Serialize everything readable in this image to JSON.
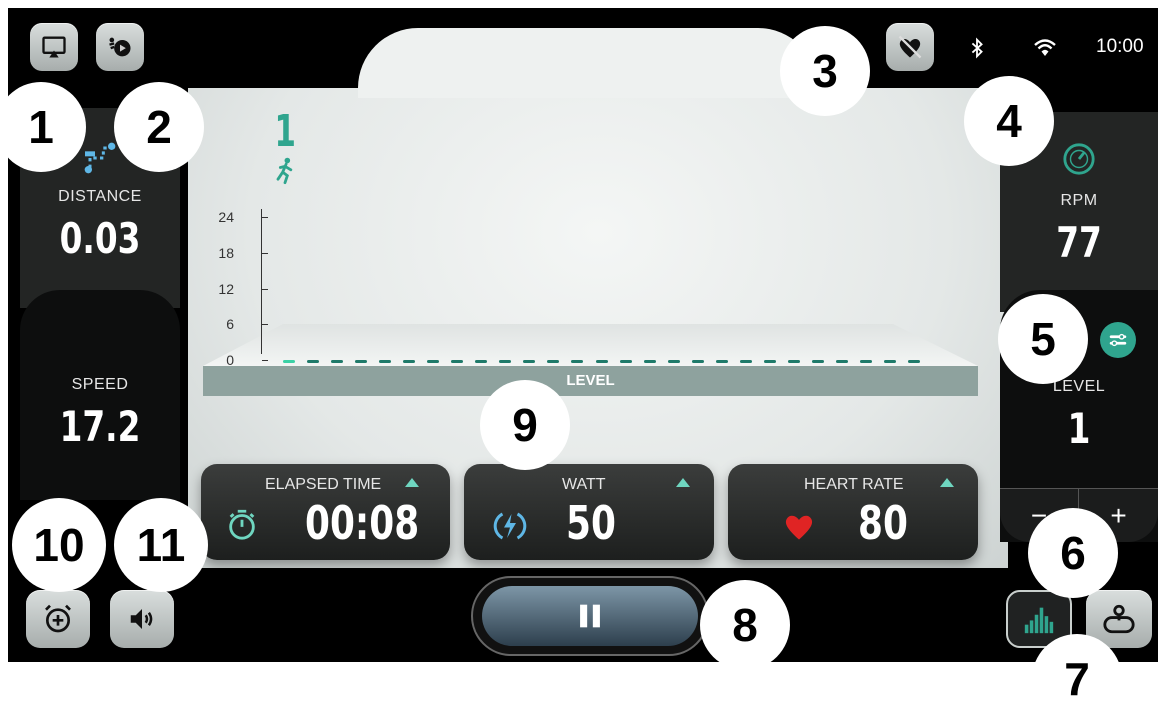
{
  "status_bar": {
    "time": "10:00"
  },
  "left_panel": {
    "distance_label": "DISTANCE",
    "distance_value": "0.03",
    "speed_label": "SPEED",
    "speed_value": "17.2"
  },
  "right_panel": {
    "rpm_label": "RPM",
    "rpm_value": "77",
    "level_label": "LEVEL",
    "level_value": "1",
    "minus_label": "−",
    "plus_label": "+"
  },
  "chart": {
    "current_level": "1",
    "axis_label": "LEVEL",
    "y_ticks": [
      "24",
      "18",
      "12",
      "6",
      "0"
    ],
    "segment_count": 27
  },
  "metrics": [
    {
      "label": "ELAPSED TIME",
      "value": "00:08"
    },
    {
      "label": "WATT",
      "value": "50"
    },
    {
      "label": "HEART RATE",
      "value": "80"
    }
  ],
  "callouts": [
    "1",
    "2",
    "3",
    "4",
    "5",
    "6",
    "7",
    "8",
    "9",
    "10",
    "11"
  ],
  "colors": {
    "accent": "#2fa58e",
    "panel": "#232524",
    "heart": "#e02424",
    "screen": "#000000"
  },
  "icons": {
    "cast": "screen-cast-icon",
    "workout_profile": "runner-profile-icon",
    "heart_monitor": "heart-monitor-off-icon",
    "bluetooth": "bluetooth-icon",
    "wifi": "wifi-icon",
    "distance": "route-pin-icon",
    "rpm": "speedometer-icon",
    "settings": "sliders-icon",
    "timer": "stopwatch-icon",
    "watt": "lightning-icon",
    "heart": "heart-icon",
    "alarm": "alarm-add-icon",
    "volume": "volume-icon",
    "pause": "pause-icon",
    "chart_view": "bar-chart-icon",
    "track_view": "track-map-icon"
  }
}
